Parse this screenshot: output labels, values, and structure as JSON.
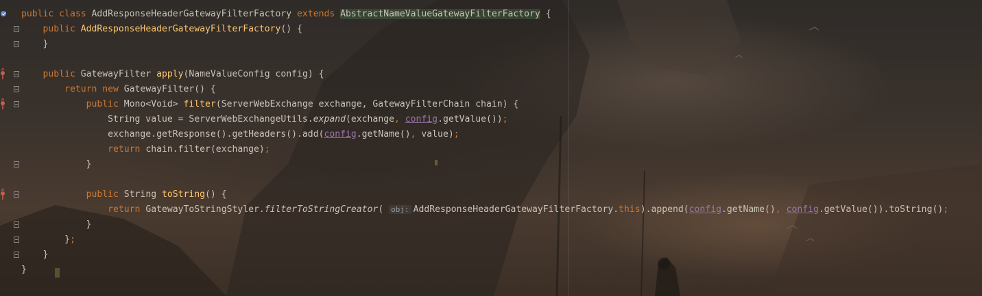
{
  "editor": {
    "lines": [
      [
        {
          "t": "public class ",
          "c": "kw"
        },
        {
          "t": "AddResponseHeaderGatewayFilterFactory ",
          "c": "plain"
        },
        {
          "t": "extends ",
          "c": "kw"
        },
        {
          "t": "AbstractNameValueGatewayFilterFactory",
          "c": "cls-hl"
        },
        {
          "t": " {",
          "c": "plain"
        }
      ],
      [
        {
          "t": "    public ",
          "c": "kw"
        },
        {
          "t": "AddResponseHeaderGatewayFilterFactory",
          "c": "fn"
        },
        {
          "t": "() {",
          "c": "plain"
        }
      ],
      [
        {
          "t": "    }",
          "c": "plain"
        }
      ],
      [],
      [
        {
          "t": "    public ",
          "c": "kw"
        },
        {
          "t": "GatewayFilter ",
          "c": "plain"
        },
        {
          "t": "apply",
          "c": "fn"
        },
        {
          "t": "(NameValueConfig config) {",
          "c": "plain"
        }
      ],
      [
        {
          "t": "        return new ",
          "c": "kw"
        },
        {
          "t": "GatewayFilter() {",
          "c": "plain"
        }
      ],
      [
        {
          "t": "            public ",
          "c": "kw"
        },
        {
          "t": "Mono<Void> ",
          "c": "plain"
        },
        {
          "t": "filter",
          "c": "fn"
        },
        {
          "t": "(ServerWebExchange exchange, GatewayFilterChain chain) {",
          "c": "plain"
        }
      ],
      [
        {
          "t": "                String value = ServerWebExchangeUtils.",
          "c": "plain"
        },
        {
          "t": "expand",
          "c": "ital"
        },
        {
          "t": "(exchange",
          "c": "plain"
        },
        {
          "t": ", ",
          "c": "kw"
        },
        {
          "t": "config",
          "c": "field"
        },
        {
          "t": ".getValue())",
          "c": "plain"
        },
        {
          "t": ";",
          "c": "kw"
        }
      ],
      [
        {
          "t": "                exchange.getResponse().getHeaders().add(",
          "c": "plain"
        },
        {
          "t": "config",
          "c": "field"
        },
        {
          "t": ".getName()",
          "c": "plain"
        },
        {
          "t": ", ",
          "c": "kw"
        },
        {
          "t": "value)",
          "c": "plain"
        },
        {
          "t": ";",
          "c": "kw"
        }
      ],
      [
        {
          "t": "                ",
          "c": "plain"
        },
        {
          "t": "return ",
          "c": "kw"
        },
        {
          "t": "chain.filter(exchange)",
          "c": "plain"
        },
        {
          "t": ";",
          "c": "kw"
        }
      ],
      [
        {
          "t": "            }",
          "c": "plain"
        }
      ],
      [],
      [
        {
          "t": "            public ",
          "c": "kw"
        },
        {
          "t": "String ",
          "c": "plain"
        },
        {
          "t": "toString",
          "c": "fn"
        },
        {
          "t": "() {",
          "c": "plain"
        }
      ],
      [
        {
          "t": "                ",
          "c": "plain"
        },
        {
          "t": "return ",
          "c": "kw"
        },
        {
          "t": "GatewayToStringStyler.",
          "c": "plain"
        },
        {
          "t": "filterToStringCreator",
          "c": "ital"
        },
        {
          "t": "( ",
          "c": "plain"
        },
        {
          "t": "obj:",
          "c": "hint"
        },
        {
          "t": "AddResponseHeaderGatewayFilterFactory.",
          "c": "plain"
        },
        {
          "t": "this",
          "c": "kw"
        },
        {
          "t": ").append(",
          "c": "plain"
        },
        {
          "t": "config",
          "c": "field"
        },
        {
          "t": ".getName()",
          "c": "plain"
        },
        {
          "t": ", ",
          "c": "kw"
        },
        {
          "t": "config",
          "c": "field"
        },
        {
          "t": ".getValue()).toString()",
          "c": "plain"
        },
        {
          "t": ";",
          "c": "kw"
        }
      ],
      [
        {
          "t": "            }",
          "c": "plain"
        }
      ],
      [
        {
          "t": "        }",
          "c": "plain"
        },
        {
          "t": ";",
          "c": "kw"
        }
      ],
      [
        {
          "t": "    }",
          "c": "plain"
        }
      ],
      [
        {
          "t": "}",
          "c": "plain"
        }
      ]
    ],
    "gutter": [
      {
        "line": 0,
        "icon": "implementation-icon",
        "color": "#5a8fd6"
      },
      {
        "line": 1,
        "icon": "fold-icon",
        "color": "#8a8a8a"
      },
      {
        "line": 2,
        "icon": "fold-icon",
        "color": "#8a8a8a"
      },
      {
        "line": 4,
        "icon": "override-icon",
        "color": "#c95d4a"
      },
      {
        "line": 5,
        "icon": "fold-icon",
        "color": "#8a8a8a"
      },
      {
        "line": 6,
        "icon": "override-icon",
        "color": "#c95d4a"
      },
      {
        "line": 10,
        "icon": "fold-icon",
        "color": "#8a8a8a"
      },
      {
        "line": 12,
        "icon": "override-icon",
        "color": "#c95d4a"
      },
      {
        "line": 14,
        "icon": "fold-icon",
        "color": "#8a8a8a"
      },
      {
        "line": 15,
        "icon": "fold-icon",
        "color": "#8a8a8a"
      },
      {
        "line": 16,
        "icon": "fold-icon",
        "color": "#8a8a8a"
      }
    ],
    "colors": {
      "keyword": "#cc7832",
      "method": "#ffc66d",
      "field": "#9876aa",
      "text": "#c9c2b8"
    }
  }
}
